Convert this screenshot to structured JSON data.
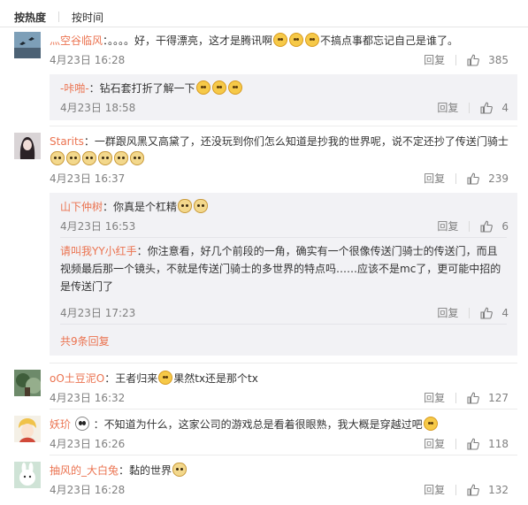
{
  "sort": {
    "hot": "按热度",
    "time": "按时间"
  },
  "comments": [
    {
      "user": "灬空谷临风",
      "text": "：。。。。好，干得漂亮，这才是腾讯啊",
      "text_after": "不搞点事都忘记自己是谁了。",
      "time": "4月23日 16:28",
      "reply": "回复",
      "likes": "385",
      "replies": [
        {
          "user": "-咔啪-",
          "text": "：钻石套打折了解一下",
          "time": "4月23日 18:58",
          "reply": "回复",
          "likes": "4"
        }
      ]
    },
    {
      "user": "Starits",
      "text": "：一群跟风黑又高黛了，还没玩到你们怎么知道是抄我的世界呢，说不定还抄了传送门骑士",
      "time": "4月23日 16:37",
      "reply": "回复",
      "likes": "239",
      "replies": [
        {
          "user": "山下仲树",
          "text": "：你真是个杠精",
          "time": "4月23日 16:53",
          "reply": "回复",
          "likes": "6"
        },
        {
          "user": "请叫我YY小红手",
          "text": "：你注意看，好几个前段的一角，确实有一个很像传送门骑士的传送门，而且视频最后那一个镜头，不就是传送门骑士的多世界的特点吗……应该不是mc了，更可能中招的是传送门了",
          "time": "4月23日 17:23",
          "reply": "回复",
          "likes": "4"
        }
      ],
      "more": "共9条回复"
    },
    {
      "user": "oO土豆泥O",
      "text": "：王者归来",
      "text_after": "果然tx还是那个tx",
      "time": "4月23日 16:32",
      "reply": "回复",
      "likes": "127"
    },
    {
      "user": "妖玠",
      "text": "：不知道为什么，这家公司的游戏总是看着很眼熟，我大概是穿越过吧",
      "time": "4月23日 16:26",
      "reply": "回复",
      "likes": "118"
    },
    {
      "user": "抽风的_大白兔",
      "text": "：黏的世界",
      "time": "4月23日 16:28",
      "reply": "回复",
      "likes": "132"
    }
  ],
  "icons": {
    "like": "thumbs-up-icon",
    "emoji_face": "face-emoji-icon",
    "emoji_doge": "doge-emoji-icon",
    "emoji_panda": "panda-emoji-icon"
  },
  "colors": {
    "username": "#eb7350",
    "meta": "#808080",
    "reply_bg": "#f2f2f5",
    "text": "#333333"
  }
}
